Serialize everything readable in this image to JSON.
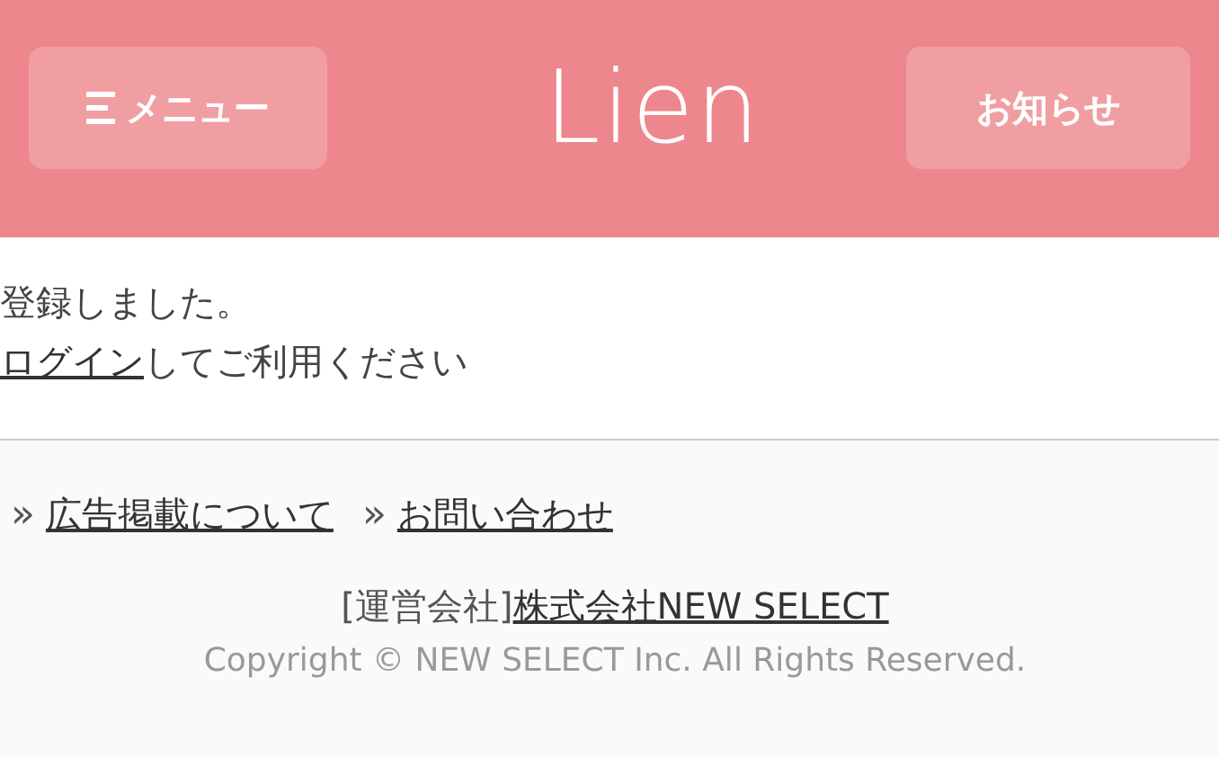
{
  "header": {
    "menu_button": "メニュー",
    "logo": "Lien",
    "notice_button": "お知らせ"
  },
  "message": {
    "line_1": "登録しました。",
    "login_link": "ログイン",
    "line_2_rest": "してご利用ください"
  },
  "footer": {
    "links": [
      {
        "marker": "»",
        "label": "広告掲載について"
      },
      {
        "marker": "»",
        "label": "お問い合わせ"
      }
    ],
    "operator_label": "[運営会社]",
    "operator_link": "株式会社NEW SELECT",
    "copyright": "Copyright © NEW SELECT Inc. All Rights Reserved."
  }
}
